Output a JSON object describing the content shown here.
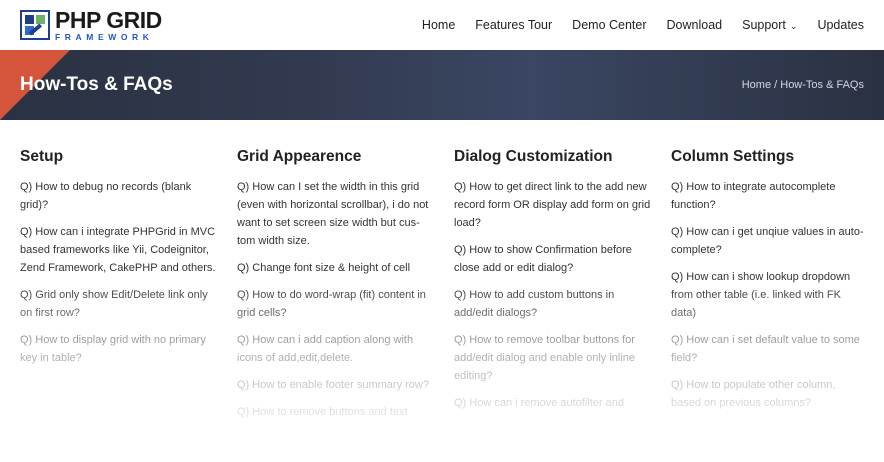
{
  "logo": {
    "main": "PHP GRID",
    "sub": "FRAMEWORK"
  },
  "nav": [
    {
      "label": "Home"
    },
    {
      "label": "Features Tour"
    },
    {
      "label": "Demo Center"
    },
    {
      "label": "Download"
    },
    {
      "label": "Support",
      "chevron": "⌄"
    },
    {
      "label": "Updates"
    }
  ],
  "banner": {
    "title": "How-Tos & FAQs",
    "breadcrumb_home": "Home",
    "breadcrumb_sep": " / ",
    "breadcrumb_current": "How-Tos & FAQs"
  },
  "columns": [
    {
      "title": "Setup",
      "items": [
        "Q) How to debug no records (blank grid)?",
        "Q) How can i integrate PHPGrid in MVC based frameworks like Yii, Codeignitor, Zend Framework, CakePHP and others.",
        "Q) Grid only show Edit/Delete link only on first row?",
        "Q) How to display grid with no primary key in table?"
      ]
    },
    {
      "title": "Grid Appearence",
      "items": [
        "Q) How can I set the width in this grid (even with horizontal scrollbar), i do not want to set screen size width but cus-tom width size.",
        "Q) Change font size & height of cell",
        "Q) How to do word-wrap (fit) content in grid cells?",
        "Q) How can i add caption along with icons of add,edit,delete.",
        "Q) How to enable footer summary row?",
        "Q) How to remove buttons and text"
      ]
    },
    {
      "title": "Dialog Customization",
      "items": [
        "Q) How to get direct link to the add new record form OR display add form on grid load?",
        "Q) How to show Confirmation before close add or edit dialog?",
        "Q) How to add custom buttons in add/edit dialogs?",
        "Q) How to remove toolbar buttons for add/edit dialog and enable only inline editing?",
        "Q) How can i remove autofilter and"
      ]
    },
    {
      "title": "Column Settings",
      "items": [
        "Q) How to integrate autocomplete function?",
        "Q) How can i get unqiue values in auto-complete?",
        "Q) How can i show lookup dropdown from other table (i.e. linked with FK data)",
        "Q) How can i set default value to some field?",
        "Q) How to populate other column, based on previous columns?"
      ]
    }
  ]
}
